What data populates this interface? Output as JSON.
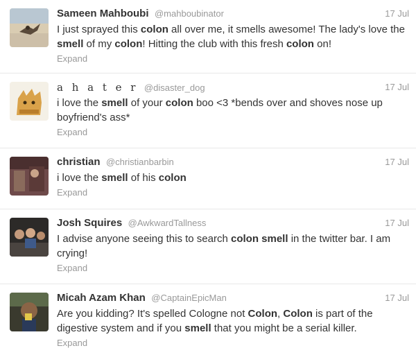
{
  "tweets": [
    {
      "fullname": "Sameen Mahboubi",
      "username": "@mahboubinator",
      "time": "17 Jul",
      "text": [
        {
          "t": "I just sprayed this "
        },
        {
          "t": "colon",
          "b": true
        },
        {
          "t": " all over me, it smells awesome! The lady's love the "
        },
        {
          "t": "smell",
          "b": true
        },
        {
          "t": " of my "
        },
        {
          "t": "colon",
          "b": true
        },
        {
          "t": "! Hitting the club with this fresh "
        },
        {
          "t": "colon",
          "b": true
        },
        {
          "t": " on!"
        }
      ],
      "expand": "Expand"
    },
    {
      "fullname": "a h a t e r",
      "username": "@disaster_dog",
      "time": "17 Jul",
      "text": [
        {
          "t": "i love the "
        },
        {
          "t": "smell",
          "b": true
        },
        {
          "t": " of your "
        },
        {
          "t": "colon",
          "b": true
        },
        {
          "t": " boo <3 *bends over and shoves nose up boyfriend's ass*"
        }
      ],
      "expand": "Expand"
    },
    {
      "fullname": "christian",
      "username": "@christianbarbin",
      "time": "17 Jul",
      "text": [
        {
          "t": "i love the "
        },
        {
          "t": "smell",
          "b": true
        },
        {
          "t": " of his "
        },
        {
          "t": "colon",
          "b": true
        }
      ],
      "expand": "Expand"
    },
    {
      "fullname": "Josh Squires",
      "username": "@AwkwardTallness",
      "time": "17 Jul",
      "text": [
        {
          "t": "I advise anyone seeing this to search "
        },
        {
          "t": "colon smell",
          "b": true
        },
        {
          "t": " in the twitter bar. I am crying!"
        }
      ],
      "expand": "Expand"
    },
    {
      "fullname": "Micah Azam Khan",
      "username": "@CaptainEpicMan",
      "time": "17 Jul",
      "text": [
        {
          "t": "Are you kidding? It's spelled Cologne not "
        },
        {
          "t": "Colon",
          "b": true
        },
        {
          "t": ", "
        },
        {
          "t": "Colon",
          "b": true
        },
        {
          "t": " is part of the digestive system and if you "
        },
        {
          "t": "smell",
          "b": true
        },
        {
          "t": " that you might be a serial killer."
        }
      ],
      "expand": "Expand"
    }
  ]
}
